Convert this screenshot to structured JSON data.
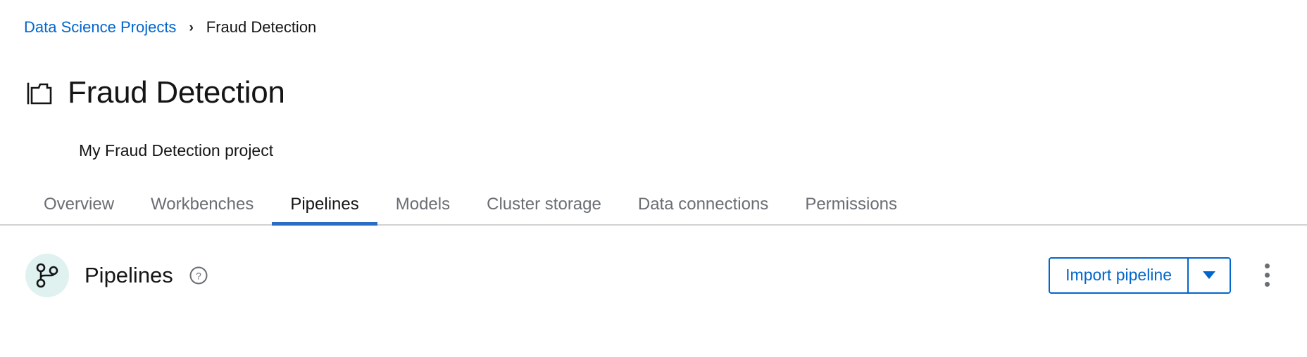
{
  "breadcrumb": {
    "parent_label": "Data Science Projects",
    "separator": "›",
    "current_label": "Fraud Detection"
  },
  "header": {
    "icon": "project-folder-icon",
    "title": "Fraud Detection",
    "subtitle": "My Fraud Detection project"
  },
  "tabs": {
    "items": [
      {
        "label": "Overview",
        "active": false
      },
      {
        "label": "Workbenches",
        "active": false
      },
      {
        "label": "Pipelines",
        "active": true
      },
      {
        "label": "Models",
        "active": false
      },
      {
        "label": "Cluster storage",
        "active": false
      },
      {
        "label": "Data connections",
        "active": false
      },
      {
        "label": "Permissions",
        "active": false
      }
    ]
  },
  "pipelines_section": {
    "badge_icon": "pipeline-branch-icon",
    "title": "Pipelines",
    "help_icon": "help-circle-icon",
    "import_button_label": "Import pipeline",
    "dropdown_icon": "caret-down-icon",
    "kebab_icon": "kebab-menu-icon"
  },
  "colors": {
    "link_blue": "#0066cc",
    "active_tab_underline": "#2b6cc4",
    "badge_teal": "#dff2f0",
    "muted_text": "#6a6e73",
    "text": "#151515",
    "border": "#d2d2d2"
  }
}
